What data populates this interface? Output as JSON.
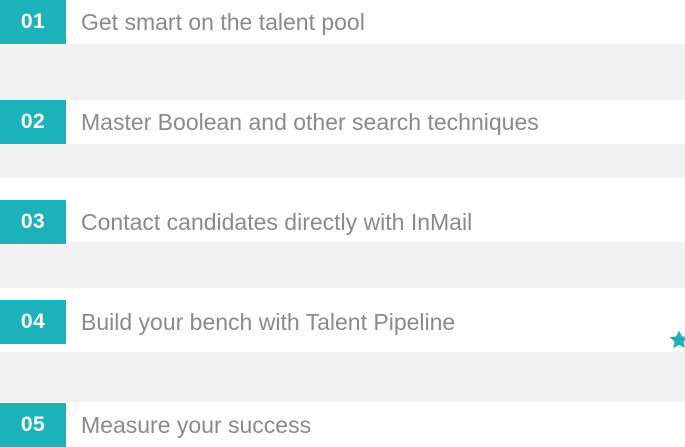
{
  "steps": [
    {
      "number": "01",
      "label": "Get smart on the talent pool"
    },
    {
      "number": "02",
      "label": "Master Boolean and other search techniques"
    },
    {
      "number": "03",
      "label": "Contact candidates directly with InMail"
    },
    {
      "number": "04",
      "label": "Build your bench with Talent Pipeline"
    },
    {
      "number": "05",
      "label": "Measure your success"
    }
  ],
  "decor": {
    "star_icon": "star-icon",
    "accent_color": "#1bb3b9",
    "text_color": "#8a8a8a",
    "band_color": "#f1f1f1"
  }
}
